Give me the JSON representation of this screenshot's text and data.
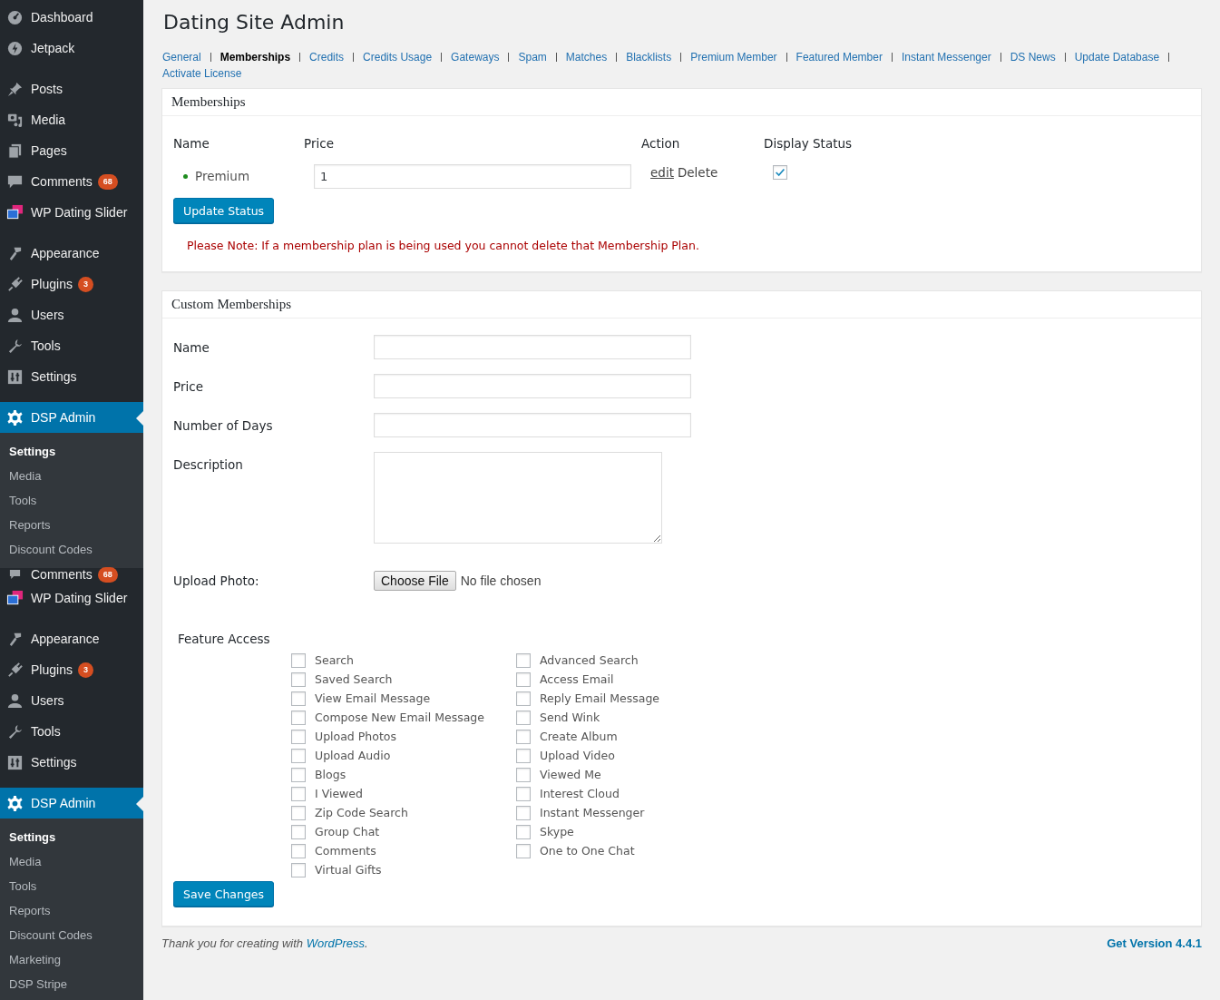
{
  "sidebar": {
    "groups": [
      [
        {
          "label": "Dashboard",
          "selected": false
        },
        {
          "label": "Jetpack",
          "selected": false
        }
      ],
      [
        {
          "label": "Posts",
          "selected": false
        },
        {
          "label": "Media",
          "selected": false
        },
        {
          "label": "Pages",
          "selected": false
        },
        {
          "label": "Comments",
          "badge": "68",
          "selected": false
        },
        {
          "label": "WP Dating Slider",
          "selected": false
        }
      ],
      [
        {
          "label": "Appearance",
          "selected": false
        },
        {
          "label": "Plugins",
          "badge": "3",
          "selected": false
        },
        {
          "label": "Users",
          "selected": false
        },
        {
          "label": "Tools",
          "selected": false
        },
        {
          "label": "Settings",
          "selected": false
        }
      ],
      [
        {
          "label": "DSP Admin",
          "selected": true,
          "children": [
            {
              "label": "Settings",
              "selected": true
            },
            {
              "label": "Media",
              "selected": false
            },
            {
              "label": "Tools",
              "selected": false
            },
            {
              "label": "Reports",
              "selected": false
            },
            {
              "label": "Discount Codes",
              "selected": false
            }
          ]
        },
        {
          "label": "Comments",
          "badge": "68",
          "selected": false,
          "clipped": true
        },
        {
          "label": "WP Dating Slider",
          "selected": false
        }
      ],
      [
        {
          "label": "Appearance",
          "selected": false
        },
        {
          "label": "Plugins",
          "badge": "3",
          "selected": false
        },
        {
          "label": "Users",
          "selected": false
        },
        {
          "label": "Tools",
          "selected": false
        },
        {
          "label": "Settings",
          "selected": false
        }
      ],
      [
        {
          "label": "DSP Admin",
          "selected": true,
          "children": [
            {
              "label": "Settings",
              "selected": true
            },
            {
              "label": "Media",
              "selected": false
            },
            {
              "label": "Tools",
              "selected": false
            },
            {
              "label": "Reports",
              "selected": false
            },
            {
              "label": "Discount Codes",
              "selected": false
            },
            {
              "label": "Marketing",
              "selected": false
            },
            {
              "label": "DSP Stripe",
              "selected": false
            }
          ]
        }
      ]
    ]
  },
  "page_title": "Dating Site Admin",
  "tabs": [
    {
      "label": "General",
      "selected": false
    },
    {
      "label": "Memberships",
      "selected": true
    },
    {
      "label": "Credits",
      "selected": false
    },
    {
      "label": "Credits Usage",
      "selected": false
    },
    {
      "label": "Gateways",
      "selected": false
    },
    {
      "label": "Spam",
      "selected": false
    },
    {
      "label": "Matches",
      "selected": false
    },
    {
      "label": "Blacklists",
      "selected": false
    },
    {
      "label": "Premium Member",
      "selected": false
    },
    {
      "label": "Featured Member",
      "selected": false
    },
    {
      "label": "Instant Messenger",
      "selected": false
    },
    {
      "label": "DS News",
      "selected": false
    },
    {
      "label": "Update Database",
      "selected": false
    },
    {
      "label": "Activate License",
      "selected": false
    }
  ],
  "memberships": {
    "title": "Memberships",
    "columns": [
      "Name",
      "Price",
      "Action",
      "Display Status"
    ],
    "rows": [
      {
        "name": "Premium",
        "color": "#1e8c1e",
        "price": "1",
        "edit_link": "edit",
        "delete": "Delete",
        "display_status": true
      }
    ],
    "update_button": "Update Status",
    "note": "Please Note: If a membership plan is being used you cannot delete that Membership Plan."
  },
  "custom_memberships": {
    "title": "Custom Memberships",
    "fields": [
      {
        "label": "Name",
        "kind": "text"
      },
      {
        "label": "Price",
        "kind": "text"
      },
      {
        "label": "Number of Days",
        "kind": "text"
      },
      {
        "label": "Description",
        "kind": "textarea"
      },
      {
        "label": "Upload Photo:",
        "kind": "file",
        "button": "Choose File",
        "status": "No file chosen"
      }
    ],
    "feature_access": {
      "label": "Feature Access",
      "options": [
        {
          "label": "Search",
          "checked": false
        },
        {
          "label": "Advanced Search",
          "checked": false
        },
        {
          "label": "Saved Search",
          "checked": false
        },
        {
          "label": "Access Email",
          "checked": false
        },
        {
          "label": "View Email Message",
          "checked": false
        },
        {
          "label": "Reply Email Message",
          "checked": false
        },
        {
          "label": "Compose New Email Message",
          "checked": false
        },
        {
          "label": "Send Wink",
          "checked": false
        },
        {
          "label": "Upload Photos",
          "checked": false
        },
        {
          "label": "Create Album",
          "checked": false
        },
        {
          "label": "Upload Audio",
          "checked": false
        },
        {
          "label": "Upload Video",
          "checked": false
        },
        {
          "label": "Blogs",
          "checked": false
        },
        {
          "label": "Viewed Me",
          "checked": false
        },
        {
          "label": "I Viewed",
          "checked": false
        },
        {
          "label": "Interest Cloud",
          "checked": false
        },
        {
          "label": "Zip Code Search",
          "checked": false
        },
        {
          "label": "Instant Messenger",
          "checked": false
        },
        {
          "label": "Group Chat",
          "checked": false
        },
        {
          "label": "Skype",
          "checked": false
        },
        {
          "label": "Comments",
          "checked": false
        },
        {
          "label": "One to One Chat",
          "checked": false
        },
        {
          "label": "Virtual Gifts",
          "checked": false
        }
      ]
    },
    "save_button": "Save Changes"
  },
  "footer": {
    "thanks": "*Thank you for creating with* ",
    "link": "WordPress",
    "thanks_end": ".",
    "version": "Get Version 4.4.1"
  }
}
